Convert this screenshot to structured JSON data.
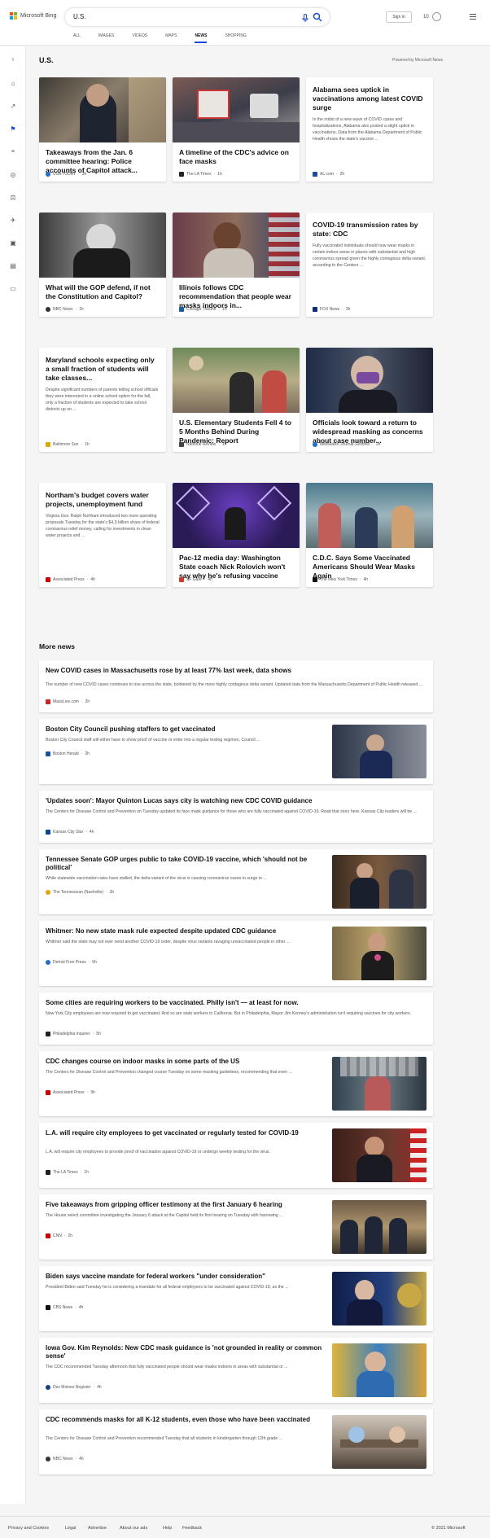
{
  "header": {
    "brand": "Microsoft Bing",
    "query": "U.S.",
    "signin": "Sign in",
    "reward_count": "10",
    "tabs": [
      "ALL",
      "IMAGES",
      "VIDEOS",
      "MAPS",
      "NEWS",
      "SHOPPING"
    ],
    "active_tab": "NEWS"
  },
  "sidebar_icons": [
    "expand-icon",
    "home-icon",
    "trending-icon",
    "flag-icon",
    "location-icon",
    "globe-icon",
    "scales-icon",
    "rocket-icon",
    "film-icon",
    "building-icon",
    "money-icon"
  ],
  "section": {
    "title": "U.S.",
    "powered_by": "Powered by Microsoft News"
  },
  "cards": [
    {
      "title": "Takeaways from the Jan. 6 committee hearing: Police accounts of Capitol attack...",
      "source": "USA TODAY",
      "time": "3h",
      "image": "photo-officer-crying",
      "snippet": ""
    },
    {
      "title": "A timeline of the CDC's advice on face masks",
      "source": "The LA Times",
      "time": "1h",
      "image": "photo-mask-sign",
      "snippet": ""
    },
    {
      "title": "Alabama sees uptick in vaccinations among latest COVID surge",
      "source": "AL.com",
      "time": "2h",
      "image": "",
      "snippet": "In the midst of a new wave of COVID cases and hospitalizations, Alabama also posted a slight uptick in vaccinations. Data from the Alabama Department of Public Health shows the state's vaccine ..."
    },
    {
      "title": "What will the GOP defend, if not the Constitution and Capitol?",
      "source": "NBC News",
      "time": "1h",
      "image": "photo-gop-leader",
      "snippet": ""
    },
    {
      "title": "Illinois follows CDC recommendation that people wear masks indoors in...",
      "source": "Chicago Tribune",
      "time": "1h",
      "image": "photo-official-speaking",
      "snippet": ""
    },
    {
      "title": "COVID-19 transmission rates by state: CDC",
      "source": "FOX News",
      "time": "3h",
      "image": "",
      "snippet": "Fully vaccinated individuals should now wear masks in certain indoor areas in places with substantial and high coronavirus spread given the highly contagious delta variant, according to the Centers ..."
    },
    {
      "title": "Maryland schools expecting only a small fraction of students will take classes...",
      "source": "Baltimore Sun",
      "time": "1h",
      "image": "",
      "snippet": "Despite significant numbers of parents telling school officials they were interested in a online school option for the fall, only a fraction of students are expected to take school districts up on ..."
    },
    {
      "title": "U.S. Elementary Students Fell 4 to 5 Months Behind During Pandemic: Report",
      "source": "National Review",
      "time": "1h",
      "image": "photo-classroom",
      "snippet": ""
    },
    {
      "title": "Officials look toward a return to widespread masking as concerns about case number...",
      "source": "Milwaukee Journal-Sentinel",
      "time": "2h",
      "image": "photo-man-mask",
      "snippet": ""
    },
    {
      "title": "Northam's budget covers water projects, unemployment fund",
      "source": "Associated Press",
      "time": "4h",
      "image": "",
      "snippet": "Virginia Gov. Ralph Northam introduced two more spending proposals Tuesday for the state's $4.3 billion share of federal coronavirus relief money, calling for investments in clean water projects and ..."
    },
    {
      "title": "Pac-12 media day: Washington State coach Nick Rolovich won't say why he's refusing vaccine",
      "source": "SF Gate",
      "time": "4h",
      "image": "photo-pac12-stage",
      "snippet": ""
    },
    {
      "title": "C.D.C. Says Some Vaccinated Americans Should Wear Masks Again",
      "source": "The New York Times",
      "time": "4h",
      "image": "photo-people-masks",
      "snippet": ""
    }
  ],
  "more_news": {
    "title": "More news",
    "items": [
      {
        "title": "New COVID cases in Massachusetts rose by at least 77% last week, data shows",
        "snippet": "The number of new COVID cases continues to rise across the state, bolstered by the more highly contagious delta variant. Updated data from the Massachusetts Department of Public Health released ...",
        "source": "MassLive.com",
        "time": "2h",
        "image": ""
      },
      {
        "title": "Boston City Council pushing staffers to get vaccinated",
        "snippet": "Boston City Council staff will either have to show proof of vaccine or enter into a regular testing regimen, Council ...",
        "source": "Boston Herald",
        "time": "2h",
        "image": "photo-podium"
      },
      {
        "title": "'Updates soon': Mayor Quinton Lucas says city is watching new CDC COVID guidance",
        "snippet": "The Centers for Disease Control and Prevention on Tuesday updated its face mask guidance for those who are fully vaccinated against COVID-19. Read that story here. Kansas City leaders will be ...",
        "source": "Kansas City Star",
        "time": "4h",
        "image": ""
      },
      {
        "title": "Tennessee Senate GOP urges public to take COVID-19 vaccine, which 'should not be political'",
        "snippet": "While statewide vaccination rates have stalled, the delta variant of the virus is causing coronavirus cases to surge in ...",
        "source": "The Tennessean (Nashville)",
        "time": "3h",
        "image": "photo-senate"
      },
      {
        "title": "Whitmer: No new state mask rule expected despite updated CDC guidance",
        "snippet": "Whitmer said the state may not ever need another COVID-19 order, despite virus variants ravaging unvaccinated people in other ...",
        "source": "Detroit Free Press",
        "time": "5h",
        "image": "photo-whitmer"
      },
      {
        "title": "Some cities are requiring workers to be vaccinated. Philly isn't — at least for now.",
        "snippet": "New York City employees are now required to get vaccinated. And so are state workers in California. But in Philadelphia, Mayor Jim Kenney's administration isn't requiring vaccines for city workers.",
        "source": "Philadelphia Inquirer",
        "time": "5h",
        "image": ""
      },
      {
        "title": "CDC changes course on indoor masks in some parts of the US",
        "snippet": "The Centers for Disease Control and Prevention changed course Tuesday on some masking guidelines, recommending that even ...",
        "source": "Associated Press",
        "time": "9h",
        "image": "photo-store-masks"
      },
      {
        "title": "L.A. will require city employees to get vaccinated or regularly tested for COVID-19",
        "snippet": "L.A. will require city employees to provide proof of vaccination against COVID-19 or undergo weekly testing for the virus.",
        "source": "The LA Times",
        "time": "1h",
        "image": "photo-la-mayor"
      },
      {
        "title": "Five takeaways from gripping officer testimony at the first January 6 hearing",
        "snippet": "The House select committee investigating the January 6 attack at the Capitol held its first hearing on Tuesday with harrowing ...",
        "source": "CNN",
        "time": "2h",
        "image": "photo-officers-sworn"
      },
      {
        "title": "Biden says vaccine mandate for federal workers \"under consideration\"",
        "snippet": "President Biden said Tuesday he is considering a mandate for all federal employees to be vaccinated against COVID-19, as the ...",
        "source": "CBS News",
        "time": "4h",
        "image": "photo-biden"
      },
      {
        "title": "Iowa Gov. Kim Reynolds: New CDC mask guidance is 'not grounded in reality or common sense'",
        "snippet": "The CDC recommended Tuesday afternoon that fully vaccinated people should wear masks indoors in areas with substantial or ...",
        "source": "Des Moines Register",
        "time": "4h",
        "image": "photo-students-masks"
      },
      {
        "title": "CDC recommends masks for all K-12 students, even those who have been vaccinated",
        "snippet": "The Centers for Disease Control and Prevention recommended Tuesday that all students in kindergarten through 12th grade ...",
        "source": "NBC News",
        "time": "4h",
        "image": "photo-classroom-masks"
      }
    ]
  },
  "footer": {
    "links": [
      "Privacy and Cookies",
      "Legal",
      "Advertise",
      "About our ads",
      "Help",
      "Feedback"
    ],
    "copyright": "© 2021 Microsoft"
  },
  "colors": {
    "accent": "#174ae4",
    "background": "#f5f5f5"
  }
}
